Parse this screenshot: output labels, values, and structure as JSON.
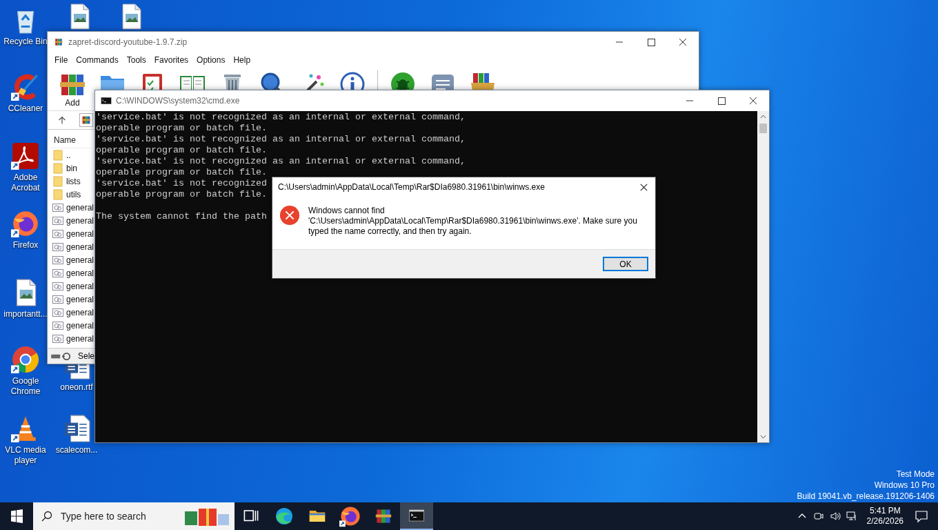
{
  "desktop_icons": [
    {
      "kind": "recycle",
      "label": "Recycle Bin"
    },
    {
      "kind": "image-file"
    },
    {
      "kind": "image-file"
    },
    {
      "kind": "ccleaner",
      "label": "CCleaner"
    },
    {
      "kind": "acrobat",
      "label": "Adobe Acrobat"
    },
    {
      "kind": "firefox",
      "label": "Firefox"
    },
    {
      "kind": "image-file",
      "label": "importantt..."
    },
    {
      "kind": "chrome",
      "label": "Google Chrome"
    },
    {
      "kind": "word",
      "label": "oneon.rtf"
    },
    {
      "kind": "vlc",
      "label": "VLC media player"
    },
    {
      "kind": "word",
      "label": "scalecom..."
    }
  ],
  "archiver": {
    "title": "zapret-discord-youtube-1.9.7.zip",
    "menu": [
      "File",
      "Commands",
      "Tools",
      "Favorites",
      "Options",
      "Help"
    ],
    "toolbar": [
      {
        "kind": "add",
        "label": "Add"
      },
      {
        "kind": "folder"
      },
      {
        "kind": "clipboard"
      },
      {
        "kind": "book"
      },
      {
        "kind": "trash"
      },
      {
        "kind": "magnifier"
      },
      {
        "kind": "wand"
      },
      {
        "kind": "info"
      },
      {
        "kind": "separator"
      },
      {
        "kind": "bug"
      },
      {
        "kind": "note"
      },
      {
        "kind": "box"
      }
    ],
    "column": "Name",
    "files": [
      {
        "kind": "folder",
        "name": ".."
      },
      {
        "kind": "folder",
        "name": "bin"
      },
      {
        "kind": "folder",
        "name": "lists"
      },
      {
        "kind": "folder",
        "name": "utils"
      },
      {
        "kind": "script",
        "name": "general"
      },
      {
        "kind": "script",
        "name": "general"
      },
      {
        "kind": "script",
        "name": "general"
      },
      {
        "kind": "script",
        "name": "general"
      },
      {
        "kind": "script",
        "name": "general"
      },
      {
        "kind": "script",
        "name": "general"
      },
      {
        "kind": "script",
        "name": "general"
      },
      {
        "kind": "script",
        "name": "general"
      },
      {
        "kind": "script",
        "name": "general"
      },
      {
        "kind": "script",
        "name": "general"
      },
      {
        "kind": "script",
        "name": "general"
      }
    ],
    "status": "Sele"
  },
  "console": {
    "title": "C:\\WINDOWS\\system32\\cmd.exe",
    "lines": [
      "'service.bat' is not recognized as an internal or external command,",
      "operable program or batch file.",
      "'service.bat' is not recognized as an internal or external command,",
      "operable program or batch file.",
      "'service.bat' is not recognized as an internal or external command,",
      "operable program or batch file.",
      "'service.bat' is not recognized",
      "operable program or batch file."
    ],
    "error_line": "The system cannot find the path"
  },
  "dialog": {
    "title": "C:\\Users\\admin\\AppData\\Local\\Temp\\Rar$DIa6980.31961\\bin\\winws.exe",
    "message": "Windows cannot find 'C:\\Users\\admin\\AppData\\Local\\Temp\\Rar$DIa6980.31961\\bin\\winws.exe'. Make sure you typed the name correctly, and then try again.",
    "button": "OK"
  },
  "system_notice": [
    "Test Mode",
    "Windows 10 Pro",
    "Build 19041.vb_release.191206-1406"
  ],
  "taskbar": {
    "search": {
      "placeholder": "Type here to search"
    },
    "apps": [
      {
        "kind": "taskview",
        "selected": false
      },
      {
        "kind": "edge",
        "selected": false
      },
      {
        "kind": "explorer",
        "selected": false
      },
      {
        "kind": "firefox",
        "selected": false
      },
      {
        "kind": "winrar",
        "selected": false
      },
      {
        "kind": "cmd",
        "selected": true
      }
    ],
    "time": "5:41 PM",
    "date": "2/26/2026"
  }
}
